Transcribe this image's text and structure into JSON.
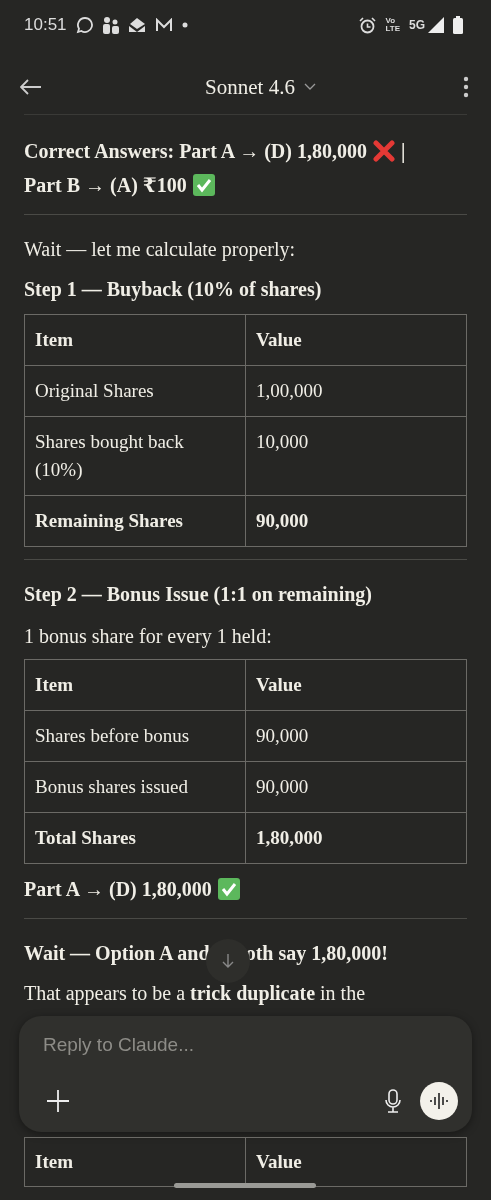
{
  "status_bar": {
    "time": "10:51",
    "volte_top": "Vo",
    "volte_bottom": "LTE",
    "network": "5G"
  },
  "app_bar": {
    "title": "Sonnet 4.6"
  },
  "blocks": [
    {
      "kind": "heading",
      "lines": [
        [
          {
            "kind": "text",
            "text": "Correct Answers: Part A → (D) 1,80,000"
          },
          {
            "kind": "cross"
          },
          {
            "kind": "text",
            "text": "|"
          }
        ],
        [
          {
            "kind": "text",
            "text": "Part B → (A) ₹100"
          },
          {
            "kind": "check"
          }
        ]
      ]
    },
    {
      "kind": "divider"
    },
    {
      "kind": "para",
      "text": "Wait — let me calculate properly:"
    },
    {
      "kind": "subheading",
      "text": "Step 1 — Buyback (10% of shares)"
    },
    {
      "kind": "table",
      "columns": [
        "Item",
        "Value"
      ],
      "rows": [
        {
          "cells": [
            "Original Shares",
            "1,00,000"
          ],
          "bold": false
        },
        {
          "cells": [
            "Shares bought back (10%)",
            "10,000"
          ],
          "bold": false
        },
        {
          "cells": [
            "Remaining Shares",
            "90,000"
          ],
          "bold": true
        }
      ]
    },
    {
      "kind": "divider"
    },
    {
      "kind": "subheading",
      "text": "Step 2 — Bonus Issue (1:1 on remaining)"
    },
    {
      "kind": "para",
      "text": "1 bonus share for every 1 held:"
    },
    {
      "kind": "table",
      "columns": [
        "Item",
        "Value"
      ],
      "rows": [
        {
          "cells": [
            "Shares before bonus",
            "90,000"
          ],
          "bold": false
        },
        {
          "cells": [
            "Bonus shares issued",
            "90,000"
          ],
          "bold": false
        },
        {
          "cells": [
            "Total Shares",
            "1,80,000"
          ],
          "bold": true
        }
      ]
    },
    {
      "kind": "heading",
      "lines": [
        [
          {
            "kind": "text",
            "text": "Part A → (D) 1,80,000"
          },
          {
            "kind": "check"
          }
        ]
      ]
    },
    {
      "kind": "divider"
    },
    {
      "kind": "split",
      "before": "Wait — Option A and",
      "after": "oth say 1,80,000!"
    },
    {
      "kind": "para",
      "text": "That appears to be a **trick duplicate** in the"
    }
  ],
  "composer": {
    "placeholder": "Reply to Claude..."
  },
  "tail_table": {
    "columns": [
      "Item",
      "Value"
    ]
  }
}
